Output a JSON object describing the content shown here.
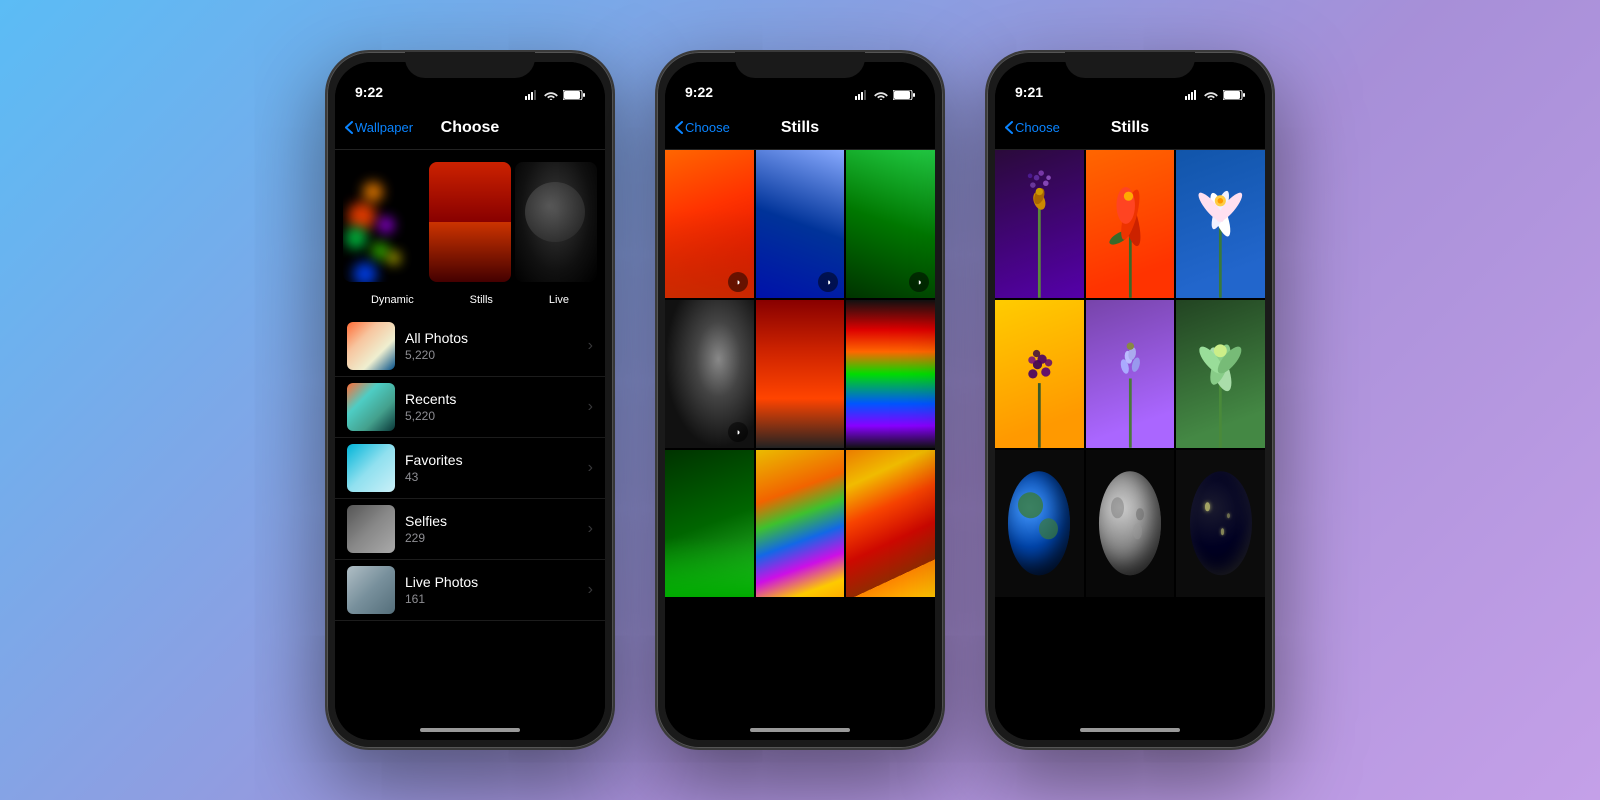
{
  "background": {
    "gradient": "linear-gradient(135deg, #5bbcf5 0%, #a78fd8 60%, #c4a0e8 100%)"
  },
  "phones": [
    {
      "id": "phone1",
      "status_bar": {
        "time": "9:22"
      },
      "nav": {
        "back_label": "Wallpaper",
        "title": "Choose"
      },
      "wallpaper_categories": [
        {
          "label": "Dynamic"
        },
        {
          "label": "Stills"
        },
        {
          "label": "Live"
        }
      ],
      "photo_albums": [
        {
          "name": "All Photos",
          "count": "5,220",
          "thumb_class": "thumb-all"
        },
        {
          "name": "Recents",
          "count": "5,220",
          "thumb_class": "thumb-recents"
        },
        {
          "name": "Favorites",
          "count": "43",
          "thumb_class": "thumb-favorites"
        },
        {
          "name": "Selfies",
          "count": "229",
          "thumb_class": "thumb-selfies"
        },
        {
          "name": "Live Photos",
          "count": "161",
          "thumb_class": "thumb-live"
        }
      ]
    },
    {
      "id": "phone2",
      "status_bar": {
        "time": "9:22"
      },
      "nav": {
        "back_label": "Choose",
        "title": "Stills"
      },
      "grid_rows": [
        [
          "orange-flow",
          "blue-flow",
          "green-flow"
        ],
        [
          "dark-swirl",
          "red-wave",
          "rainbow"
        ],
        [
          "green-stripe",
          "yellow-stripe",
          "orange-stripe"
        ]
      ]
    },
    {
      "id": "phone3",
      "status_bar": {
        "time": "9:21"
      },
      "nav": {
        "back_label": "Choose",
        "title": "Stills"
      },
      "grid_rows": [
        [
          "purple-flower",
          "red-flower",
          "blue-flower"
        ],
        [
          "yellow-flower",
          "lavender-flower",
          "green-flower"
        ],
        [
          "earth",
          "moon",
          "night-earth"
        ]
      ]
    }
  ]
}
